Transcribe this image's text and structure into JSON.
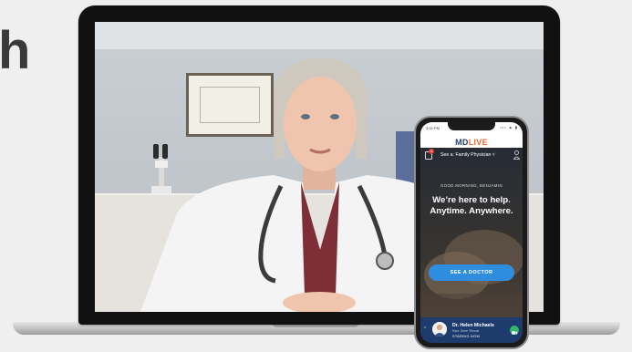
{
  "page": {
    "headline_fragment": "h",
    "accent_color": "#2f8de0",
    "brand_orange": "#ee6a2f",
    "brand_navy": "#1f3f73"
  },
  "laptop": {
    "screen_content": "doctor-video-call"
  },
  "phone": {
    "status_time": "3:02 PM",
    "status_icons": "••• ▲ ▮",
    "logo": {
      "part1": "MD",
      "part2": "LIVE"
    },
    "header": {
      "notification_count": "1",
      "visit_selector": "See a: Family Physician ˅"
    },
    "hero": {
      "greeting": "GOOD MORNING, BENJAMIN",
      "line1": "We’re here to help.",
      "line2": "Anytime. Anywhere."
    },
    "cta": {
      "label": "SEE A DOCTOR"
    },
    "pending_visit": {
      "chevron": "^",
      "doctor_name": "Dr. Helen Michaels",
      "reason": "Rsn: Sore Throat",
      "status": "STARING NOW"
    }
  }
}
